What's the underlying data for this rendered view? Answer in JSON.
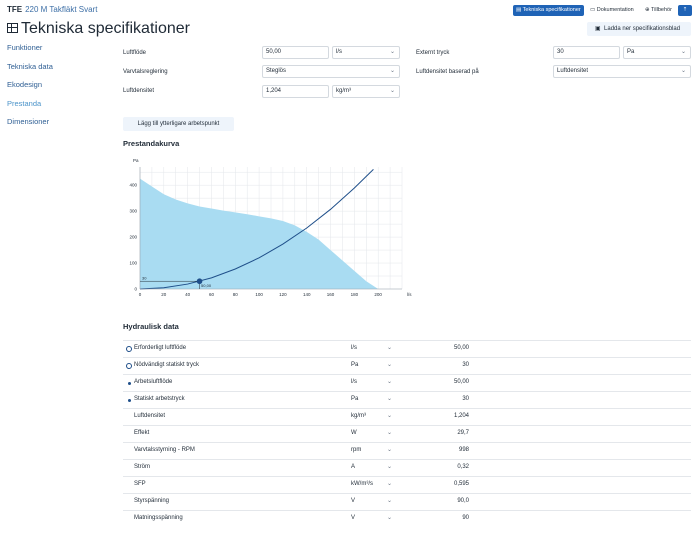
{
  "header": {
    "brand_code": "TFE",
    "brand_name": "220 M Takfläkt Svart",
    "btn_spec": "Tekniska specifikationer",
    "btn_docs": "Dokumentation",
    "btn_acc": "Tillbehör",
    "btn_arrow": "⇡"
  },
  "page": {
    "title": "Tekniska specifikationer",
    "download": "Ladda ner specifikationsblad"
  },
  "sidebar": {
    "items": [
      {
        "label": "Funktioner"
      },
      {
        "label": "Tekniska data"
      },
      {
        "label": "Ekodesign"
      },
      {
        "label": "Prestanda"
      },
      {
        "label": "Dimensioner"
      }
    ]
  },
  "form": {
    "airflow_label": "Luftflöde",
    "airflow_value": "50,00",
    "airflow_unit": "l/s",
    "speed_label": "Varvtalsreglering",
    "speed_value": "Steglös",
    "density_label": "Luftdensitet",
    "density_value": "1,204",
    "density_unit": "kg/m³",
    "ext_label": "Externt tryck",
    "ext_value": "30",
    "ext_unit": "Pa",
    "basis_label": "Luftdensitet baserad på",
    "basis_value": "Luftdensitet"
  },
  "actions": {
    "add_point": "Lägg till ytterligare arbetspunkt"
  },
  "chart_data": {
    "type": "area",
    "title": "Prestandakurva",
    "xlabel": "l/s",
    "ylabel": "Pa",
    "xlim": [
      0,
      220
    ],
    "ylim": [
      0,
      470
    ],
    "x_ticks": [
      0,
      20,
      40,
      60,
      80,
      100,
      120,
      140,
      160,
      180,
      200
    ],
    "y_ticks": [
      0,
      100,
      200,
      300,
      400
    ],
    "grid": true,
    "colors": {
      "area": "#a9dcf2",
      "curve": "#1f4f8a",
      "grid": "#e3e6ea"
    },
    "series": [
      {
        "kind": "area",
        "x": [
          0,
          10,
          20,
          30,
          40,
          50,
          60,
          70,
          80,
          90,
          100,
          110,
          120,
          130,
          140,
          150,
          160,
          170,
          180,
          190,
          200
        ],
        "y": [
          425,
          395,
          365,
          345,
          330,
          318,
          310,
          302,
          295,
          288,
          280,
          272,
          262,
          245,
          220,
          190,
          150,
          110,
          70,
          30,
          0
        ]
      },
      {
        "kind": "line",
        "x": [
          0,
          20,
          40,
          60,
          80,
          100,
          120,
          140,
          160,
          180,
          196
        ],
        "y": [
          0,
          5,
          19,
          43,
          77,
          120,
          173,
          235,
          307,
          389,
          461
        ]
      }
    ],
    "operating_point": {
      "x": 50,
      "y": 30,
      "x_label": "50,00",
      "y_label": "30"
    }
  },
  "hydraulic": {
    "title": "Hydraulisk data",
    "rows": [
      {
        "marker": "ring",
        "label": "Erforderligt luftflöde",
        "value": "50,00",
        "unit": "l/s",
        "chev": "⌄"
      },
      {
        "marker": "ring",
        "label": "Nödvändigt statiskt tryck",
        "value": "30",
        "unit": "Pa",
        "chev": "⌄"
      },
      {
        "marker": "dot",
        "label": "Arbetsluftflöde",
        "value": "50,00",
        "unit": "l/s",
        "chev": "⌄"
      },
      {
        "marker": "dot",
        "label": "Statiskt arbetstryck",
        "value": "30",
        "unit": "Pa",
        "chev": "⌄"
      },
      {
        "marker": "",
        "label": "Luftdensitet",
        "value": "1,204",
        "unit": "kg/m³",
        "chev": "⌄"
      },
      {
        "marker": "",
        "label": "Effekt",
        "value": "29,7",
        "unit": "W",
        "chev": "⌄"
      },
      {
        "marker": "",
        "label": "Varvtalsstyrning - RPM",
        "value": "998",
        "unit": "rpm",
        "chev": "⌄"
      },
      {
        "marker": "",
        "label": "Ström",
        "value": "0,32",
        "unit": "A",
        "chev": "⌄"
      },
      {
        "marker": "",
        "label": "SFP",
        "value": "0,595",
        "unit": "kW/m³/s",
        "chev": "⌄"
      },
      {
        "marker": "",
        "label": "Styrspänning",
        "value": "90,0",
        "unit": "V",
        "chev": "⌄"
      },
      {
        "marker": "",
        "label": "Matningsspänning",
        "value": "90",
        "unit": "V",
        "chev": "⌄"
      }
    ]
  }
}
